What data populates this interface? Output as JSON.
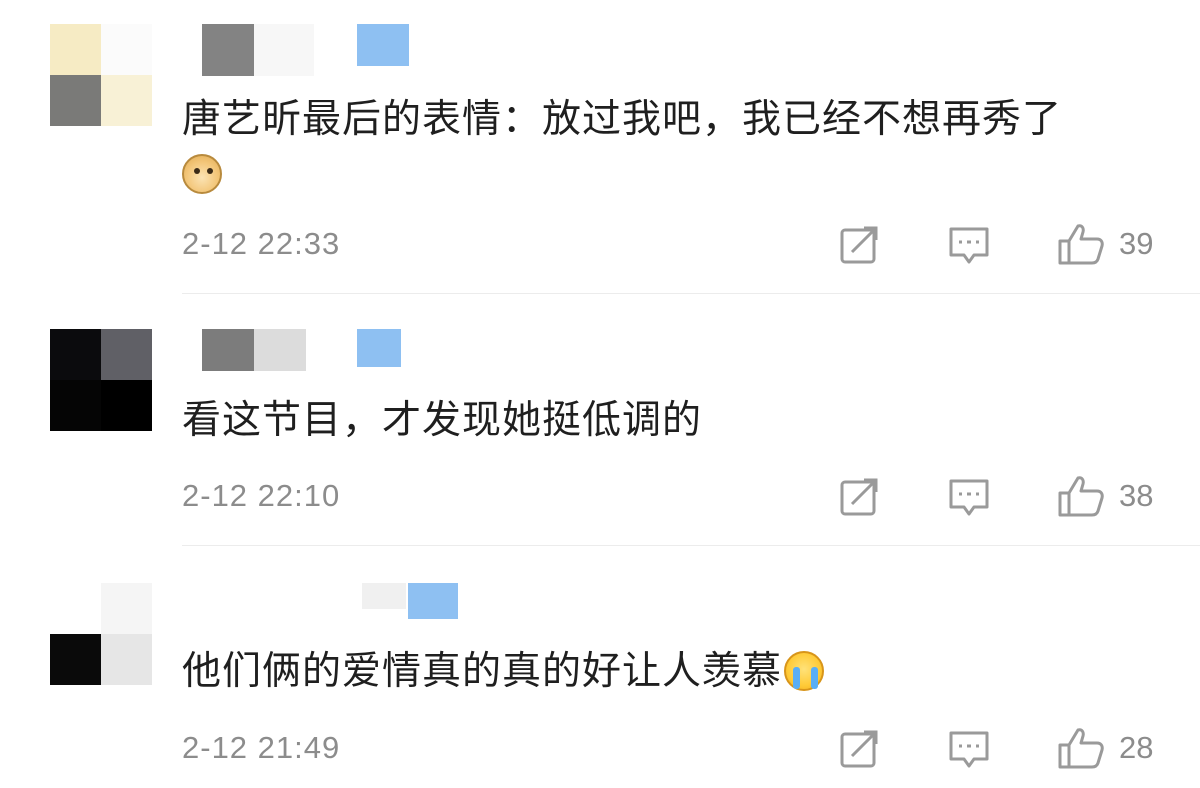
{
  "comments": [
    {
      "text": "唐艺昕最后的表情：放过我吧，我已经不想再秀了",
      "emoji": "doge-emoji",
      "time": "2-12 22:33",
      "likes": "39"
    },
    {
      "text": "看这节目，才发现她挺低调的",
      "emoji": "",
      "time": "2-12 22:10",
      "likes": "38"
    },
    {
      "text": "他们俩的爱情真的真的好让人羡慕",
      "emoji": "crying-emoji",
      "time": "2-12 21:49",
      "likes": "28"
    }
  ],
  "icons": {
    "share": "share-icon",
    "reply": "comment-icon",
    "like": "thumbs-up-icon"
  },
  "colors": {
    "text": "#1f1f1f",
    "meta": "#8c8c8c",
    "icon": "#9a9a9a",
    "divider": "#ececec",
    "badge": "#8ec0f2"
  }
}
